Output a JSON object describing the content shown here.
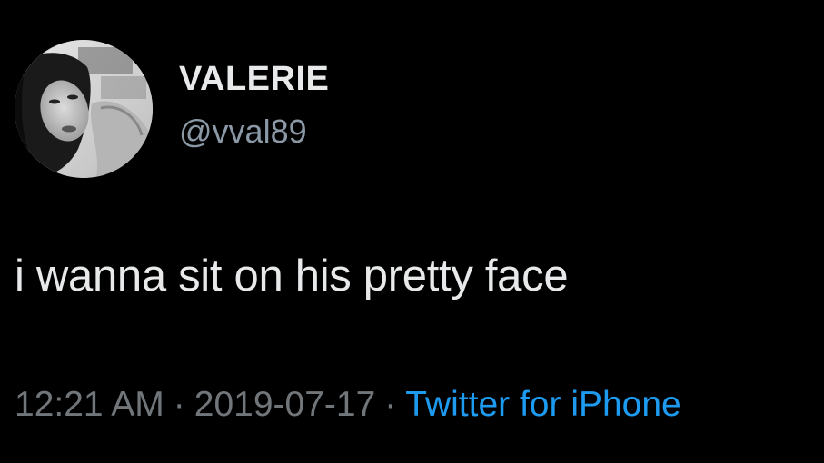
{
  "user": {
    "display_name": "VALERIE",
    "handle": "@vval89",
    "avatar_icon": "profile-photo"
  },
  "tweet": {
    "text": "i wanna sit on his pretty face",
    "time": "12:21 AM",
    "date": "2019-07-17",
    "separator": "·",
    "source": "Twitter for iPhone"
  },
  "colors": {
    "background": "#000000",
    "text": "#e7e9ea",
    "secondary": "#71767b",
    "link": "#1d9bf0"
  }
}
